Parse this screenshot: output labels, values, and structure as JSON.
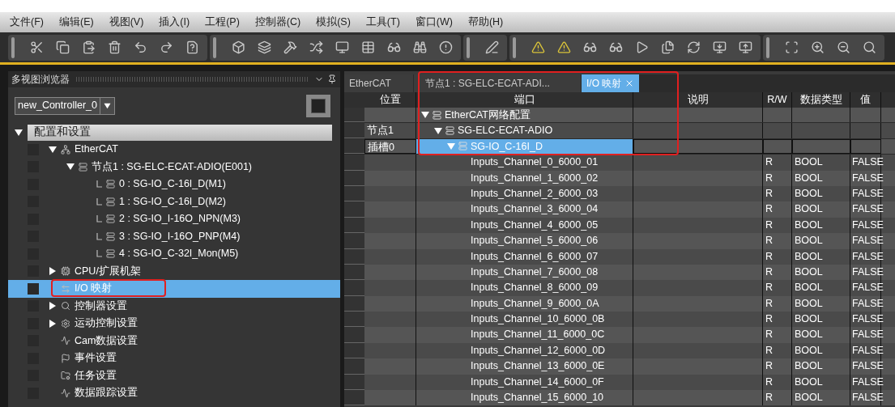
{
  "menu": [
    "文件(F)",
    "编辑(E)",
    "视图(V)",
    "插入(I)",
    "工程(P)",
    "控制器(C)",
    "模拟(S)",
    "工具(T)",
    "窗口(W)",
    "帮助(H)"
  ],
  "browser": {
    "title": "多视图浏览器",
    "controller": "new_Controller_0",
    "section": {
      "label": "配置和设置",
      "expanded": true
    },
    "tree": [
      {
        "label": "EtherCAT",
        "expanded": true,
        "selected": false,
        "children": [
          {
            "label": "节点1 : SG-ELC-ECAT-ADIO(E001)",
            "expanded": true,
            "selected": false,
            "children": [
              {
                "label": "0 : SG-IO_C-16I_D(M1)",
                "selected": false
              },
              {
                "label": "1 : SG-IO_C-16I_D(M2)",
                "selected": false
              },
              {
                "label": "2 : SG-IO_I-16O_NPN(M3)",
                "selected": false
              },
              {
                "label": "3 : SG-IO_I-16O_PNP(M4)",
                "selected": false
              },
              {
                "label": "4 : SG-IO_C-32I_Mon(M5)",
                "selected": false
              }
            ]
          }
        ]
      },
      {
        "label": "CPU/扩展机架",
        "expanded": false,
        "selected": false
      },
      {
        "label": "I/O 映射",
        "selected": true,
        "highlighted": true
      },
      {
        "label": "控制器设置",
        "expanded": false,
        "selected": false
      },
      {
        "label": "运动控制设置",
        "expanded": false,
        "selected": false
      },
      {
        "label": "Cam数据设置",
        "selected": false
      },
      {
        "label": "事件设置",
        "selected": false
      },
      {
        "label": "任务设置",
        "selected": false
      },
      {
        "label": "数据跟踪设置",
        "selected": false
      }
    ]
  },
  "tabs": [
    {
      "label": "EtherCAT",
      "selected": false,
      "closable": false
    },
    {
      "label": "节点1 : SG-ELC-ECAT-ADI...",
      "selected": false,
      "closable": false
    },
    {
      "label": "I/O 映射",
      "selected": true,
      "closable": true
    }
  ],
  "table": {
    "columns": [
      "位置",
      "端口",
      "说明",
      "R/W",
      "数据类型",
      "值"
    ],
    "tree_rows": [
      {
        "position": "",
        "port": "EtherCAT网络配置",
        "expanded": true,
        "selected": false
      },
      {
        "position": "节点1",
        "port": "SG-ELC-ECAT-ADIO",
        "expanded": true,
        "selected": false
      },
      {
        "position": "插槽0",
        "port": "SG-IO_C-16I_D",
        "expanded": true,
        "selected": true
      }
    ],
    "rows": [
      {
        "port": "Inputs_Channel_0_6000_01",
        "rw": "R",
        "type": "BOOL",
        "value": "FALSE"
      },
      {
        "port": "Inputs_Channel_1_6000_02",
        "rw": "R",
        "type": "BOOL",
        "value": "FALSE"
      },
      {
        "port": "Inputs_Channel_2_6000_03",
        "rw": "R",
        "type": "BOOL",
        "value": "FALSE"
      },
      {
        "port": "Inputs_Channel_3_6000_04",
        "rw": "R",
        "type": "BOOL",
        "value": "FALSE"
      },
      {
        "port": "Inputs_Channel_4_6000_05",
        "rw": "R",
        "type": "BOOL",
        "value": "FALSE"
      },
      {
        "port": "Inputs_Channel_5_6000_06",
        "rw": "R",
        "type": "BOOL",
        "value": "FALSE"
      },
      {
        "port": "Inputs_Channel_6_6000_07",
        "rw": "R",
        "type": "BOOL",
        "value": "FALSE"
      },
      {
        "port": "Inputs_Channel_7_6000_08",
        "rw": "R",
        "type": "BOOL",
        "value": "FALSE"
      },
      {
        "port": "Inputs_Channel_8_6000_09",
        "rw": "R",
        "type": "BOOL",
        "value": "FALSE"
      },
      {
        "port": "Inputs_Channel_9_6000_0A",
        "rw": "R",
        "type": "BOOL",
        "value": "FALSE"
      },
      {
        "port": "Inputs_Channel_10_6000_0B",
        "rw": "R",
        "type": "BOOL",
        "value": "FALSE"
      },
      {
        "port": "Inputs_Channel_11_6000_0C",
        "rw": "R",
        "type": "BOOL",
        "value": "FALSE"
      },
      {
        "port": "Inputs_Channel_12_6000_0D",
        "rw": "R",
        "type": "BOOL",
        "value": "FALSE"
      },
      {
        "port": "Inputs_Channel_13_6000_0E",
        "rw": "R",
        "type": "BOOL",
        "value": "FALSE"
      },
      {
        "port": "Inputs_Channel_14_6000_0F",
        "rw": "R",
        "type": "BOOL",
        "value": "FALSE"
      },
      {
        "port": "Inputs_Channel_15_6000_10",
        "rw": "R",
        "type": "BOOL",
        "value": "FALSE"
      }
    ]
  }
}
